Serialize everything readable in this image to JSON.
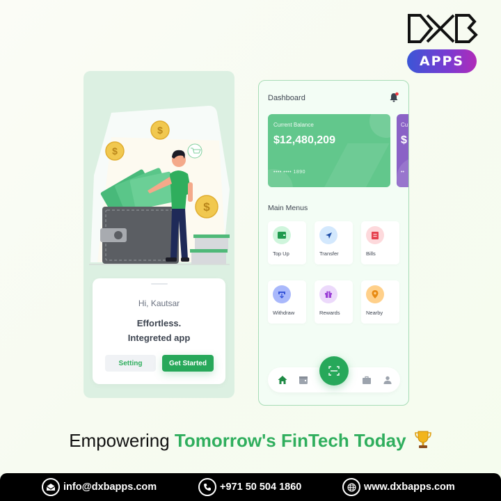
{
  "brand": {
    "logo_text": "DXB",
    "badge_label": "APPS",
    "badge_gradient": [
      "#3b56d6",
      "#7b3ad1",
      "#b02bb8"
    ]
  },
  "left_phone": {
    "illustration": {
      "elements": [
        "wallet",
        "cash-notes",
        "gold-coin",
        "gold-coin",
        "gold-coin",
        "man-in-green-shirt",
        "shopping-cart-bubble",
        "stacked-boxes"
      ],
      "coin_symbol": "$"
    },
    "welcome_card": {
      "greeting": "Hi, Kautsar",
      "headline_line1": "Effortless.",
      "headline_line2": "Integreted app",
      "setting_label": "Setting",
      "get_started_label": "Get Started"
    }
  },
  "right_phone": {
    "title": "Dashboard",
    "notification_icon": "bell-icon",
    "cards": [
      {
        "label": "Current Balance",
        "balance": "$12,480,209",
        "masked_number": "•••• ••••  1890",
        "color": "#62c78c"
      },
      {
        "label": "Cu",
        "balance": "$",
        "masked_number": "••",
        "color": "#8a62c6"
      }
    ],
    "main_menus_title": "Main Menus",
    "menus": [
      {
        "label": "Top Up",
        "icon": "wallet-icon",
        "bg": "#cff5dc",
        "fg": "#1f9a4e"
      },
      {
        "label": "Transfer",
        "icon": "send-icon",
        "bg": "#d3e8fd",
        "fg": "#1f4ea8"
      },
      {
        "label": "Bills",
        "icon": "bill-icon",
        "bg": "#fdd9dc",
        "fg": "#e6414f"
      },
      {
        "label": "Withdraw",
        "icon": "withdraw-icon",
        "bg": "#a9b8fb",
        "fg": "#3654d9"
      },
      {
        "label": "Rewards",
        "icon": "gift-icon",
        "bg": "#ecd9fb",
        "fg": "#9b3fd6"
      },
      {
        "label": "Nearby",
        "icon": "location-pin-icon",
        "bg": "#ffd08a",
        "fg": "#e88a12"
      }
    ],
    "bottom_nav": {
      "items": [
        "home-icon",
        "calendar-icon",
        "scan-icon",
        "briefcase-icon",
        "user-icon"
      ],
      "active": "home-icon"
    }
  },
  "tagline": {
    "part1": "Empowering ",
    "part2": "Tomorrow's FinTech Today",
    "emoji": "trophy-icon"
  },
  "footer": {
    "email": "info@dxbapps.com",
    "phone": "+971 50 504 1860",
    "website": "www.dxbapps.com"
  },
  "colors": {
    "primary_green": "#27a85a",
    "tagline_green": "#2fae5d",
    "text_dark": "#3d4450"
  }
}
